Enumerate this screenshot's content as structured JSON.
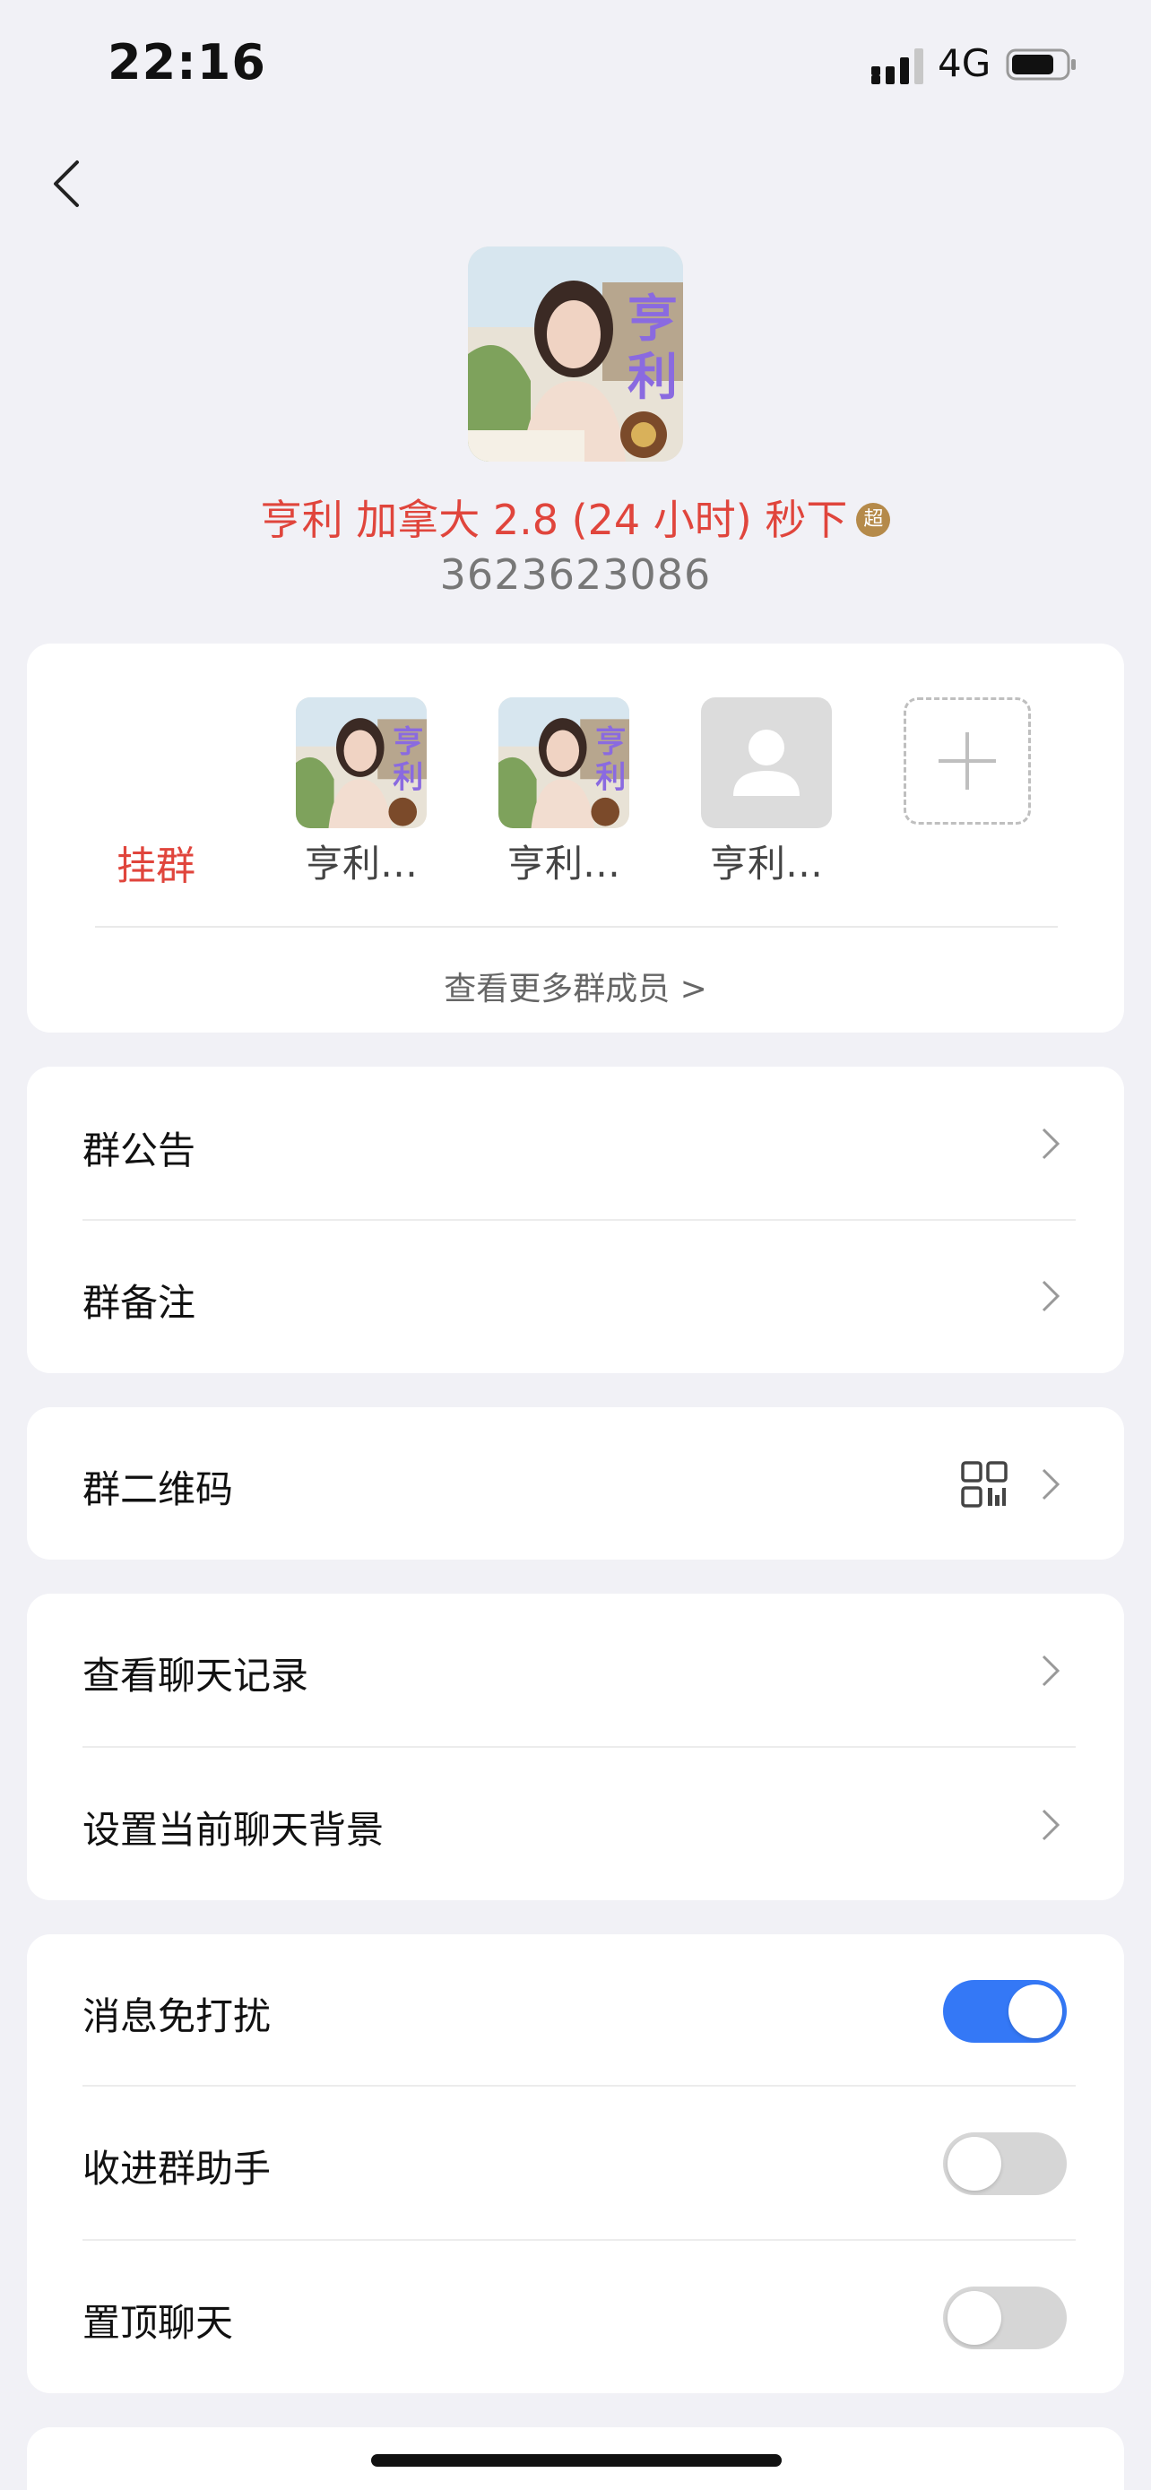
{
  "status_bar": {
    "time": "22:16",
    "network": "4G"
  },
  "group": {
    "name": "亨利  加拿大 2.8 (24 小时) 秒下",
    "vip_badge": "超",
    "id": "3623623086"
  },
  "members": {
    "label": "挂群",
    "list": [
      {
        "name": "亨利…",
        "avatar": "group-photo"
      },
      {
        "name": "亨利…",
        "avatar": "group-photo"
      },
      {
        "name": "亨利…",
        "avatar": "default-person"
      }
    ],
    "more_label": "查看更多群成员 >"
  },
  "rows": {
    "announcement": "群公告",
    "remark": "群备注",
    "qr_code": "群二维码",
    "chat_history": "查看聊天记录",
    "chat_background": "设置当前聊天背景",
    "do_not_disturb": "消息免打扰",
    "group_assistant": "收进群助手",
    "pin_chat": "置顶聊天"
  },
  "toggles": {
    "do_not_disturb": true,
    "group_assistant": false,
    "pin_chat": false
  },
  "colors": {
    "accent_red": "#e0453c",
    "toggle_on": "#3478f6",
    "background": "#f1f1f6"
  }
}
